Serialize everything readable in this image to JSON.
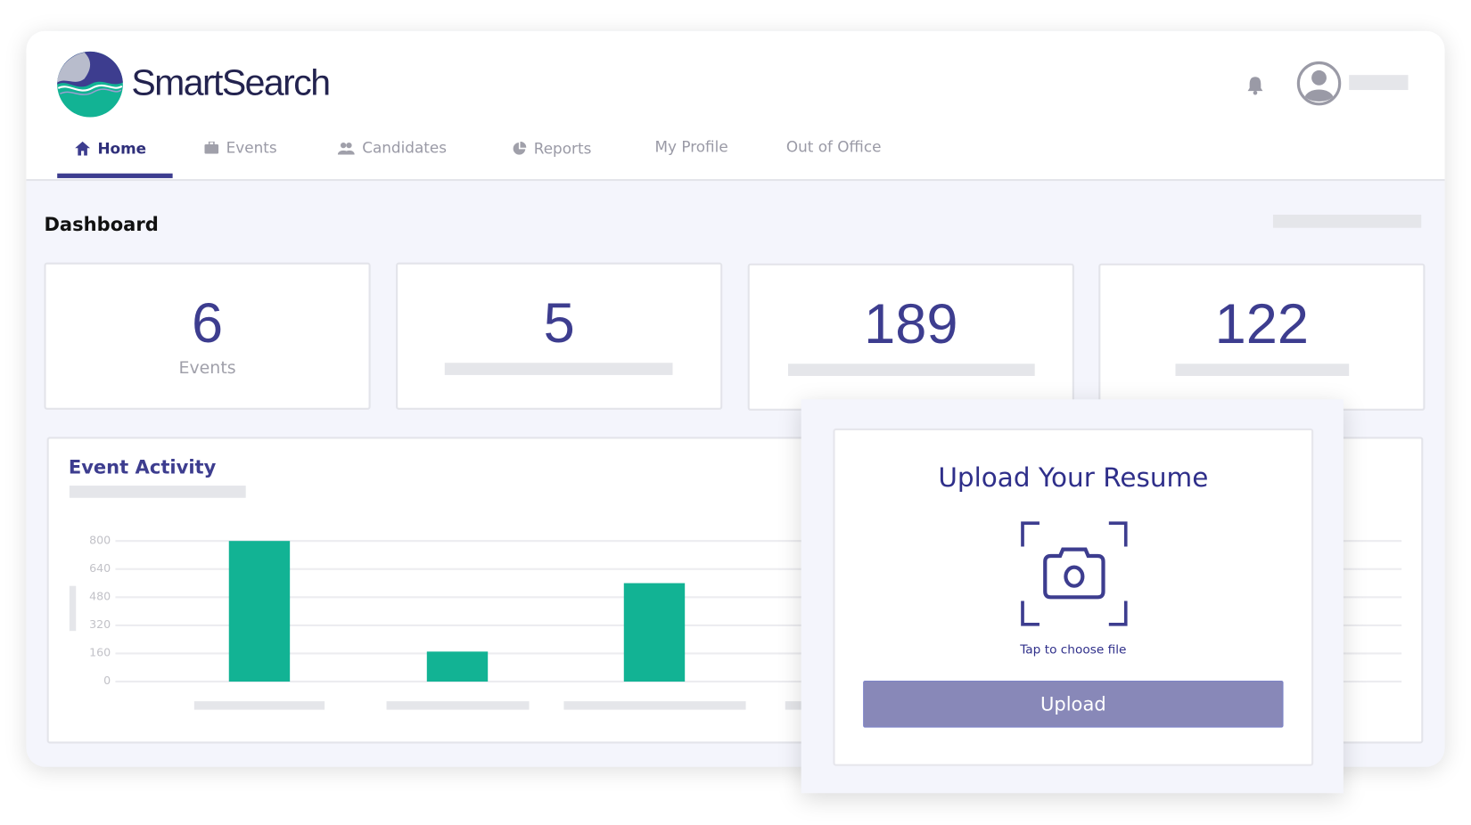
{
  "app": {
    "brand": "SmartSearch",
    "brand_colors": {
      "primary": "#3d3d8f",
      "accent": "#12b394"
    }
  },
  "nav": {
    "items": [
      {
        "label": "Home",
        "icon": "home-icon",
        "active": true
      },
      {
        "label": "Events",
        "icon": "briefcase-icon"
      },
      {
        "label": "Candidates",
        "icon": "users-icon"
      },
      {
        "label": "Reports",
        "icon": "pie-chart-icon"
      },
      {
        "label": "My Profile"
      },
      {
        "label": "Out of Office"
      }
    ]
  },
  "header": {
    "notification_icon": "bell-icon",
    "avatar_icon": "user-avatar-icon"
  },
  "dashboard": {
    "title": "Dashboard",
    "stats": [
      {
        "value": "6",
        "label": "Events"
      },
      {
        "value": "5"
      },
      {
        "value": "189"
      },
      {
        "value": "122"
      }
    ]
  },
  "chart_data": {
    "type": "bar",
    "title": "Event Activity",
    "yticks": [
      "800",
      "640",
      "480",
      "320",
      "160",
      "0"
    ],
    "ylim": [
      0,
      800
    ],
    "values": [
      800,
      170,
      560
    ],
    "grid": true,
    "bar_color": "#12b394"
  },
  "modal": {
    "title": "Upload Your Resume",
    "icon": "camera-icon",
    "hint": "Tap to choose file",
    "button_label": "Upload"
  }
}
